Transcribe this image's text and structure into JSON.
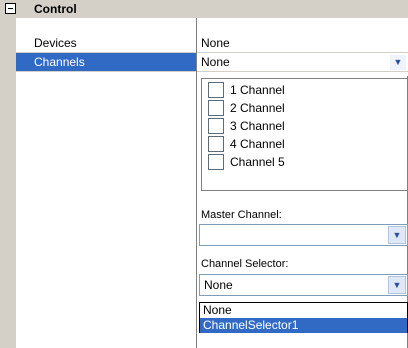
{
  "category": {
    "title": "Control"
  },
  "rows": [
    {
      "name": "Devices",
      "value": "None"
    },
    {
      "name": "Channels",
      "value": "None"
    }
  ],
  "channels_list": [
    "1 Channel",
    "2 Channel",
    "3 Channel",
    "4 Channel",
    "Channel 5"
  ],
  "master_channel": {
    "label": "Master Channel:",
    "value": ""
  },
  "channel_selector": {
    "label": "Channel Selector:",
    "value": "None",
    "options": [
      "None",
      "ChannelSelector1"
    ],
    "highlighted": "ChannelSelector1"
  },
  "icons": {
    "expander": "minus-box-icon",
    "dropdown": "chevron-down-icon"
  },
  "colors": {
    "selection": "#316ac5",
    "header_bg": "#d4d0c8"
  }
}
